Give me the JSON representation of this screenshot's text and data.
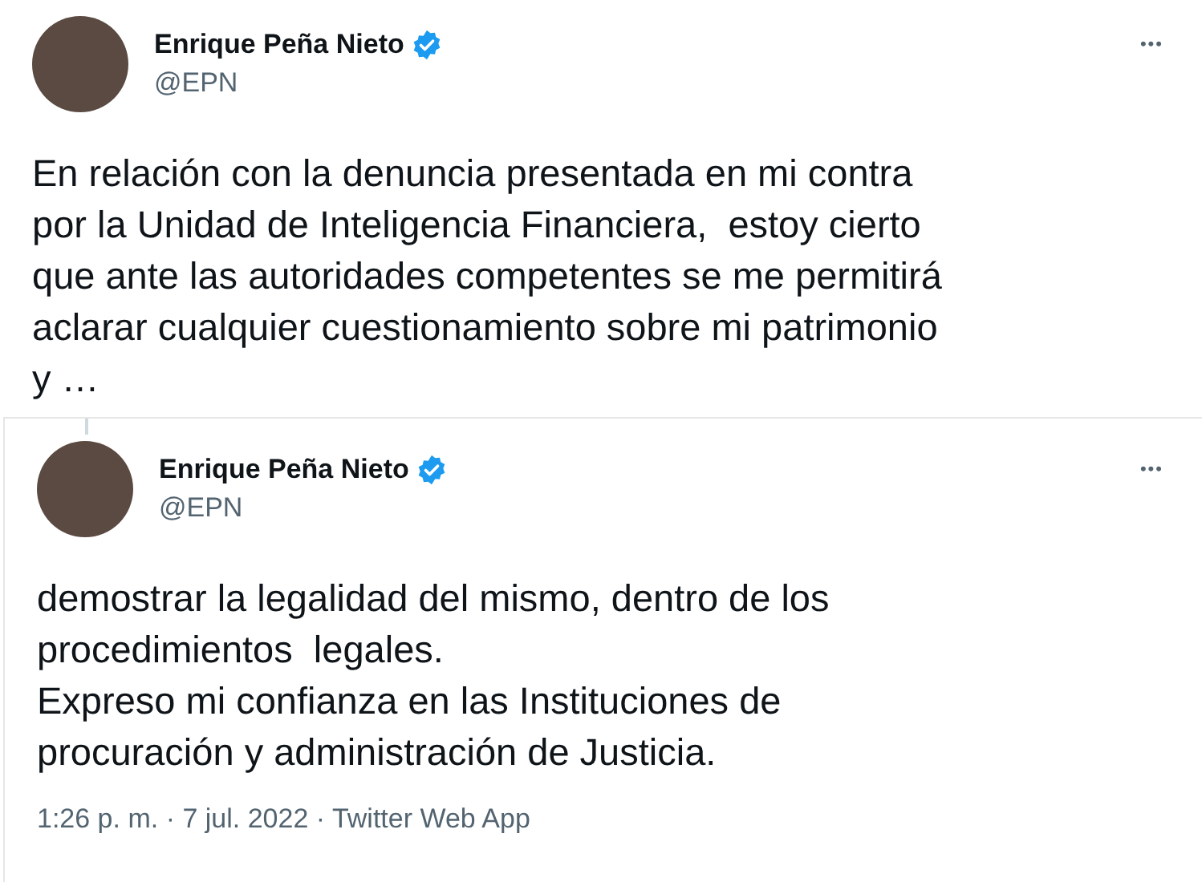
{
  "tweets": [
    {
      "author": {
        "name": "Enrique Peña Nieto",
        "handle": "@EPN",
        "verified": true
      },
      "more": "•••",
      "lines": [
        "En relación con la denuncia presentada en mi contra",
        "por la Unidad de Inteligencia Financiera,  estoy cierto",
        "que ante las autoridades competentes se me permitirá",
        "aclarar cualquier cuestionamiento sobre mi patrimonio",
        "y …"
      ]
    },
    {
      "author": {
        "name": "Enrique Peña Nieto",
        "handle": "@EPN",
        "verified": true
      },
      "more": "•••",
      "lines": [
        "demostrar la legalidad del mismo, dentro de los",
        "procedimientos  legales.",
        "Expreso mi confianza en las Instituciones de",
        "procuración y administración de Justicia."
      ],
      "meta": "1:26 p. m. · 7 jul. 2022 · Twitter Web App"
    }
  ]
}
